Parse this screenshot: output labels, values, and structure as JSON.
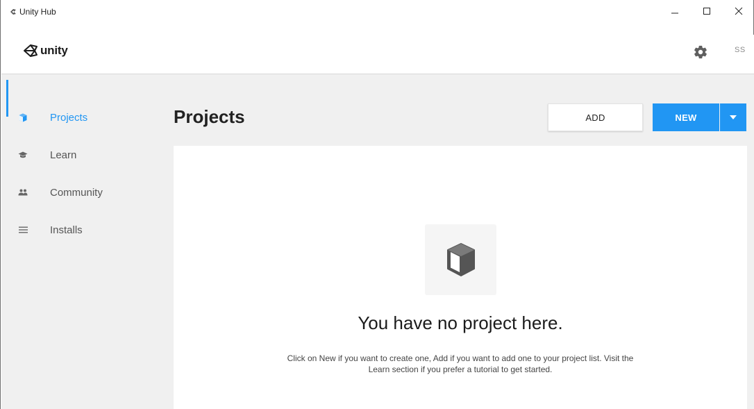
{
  "window": {
    "title": "Unity Hub",
    "controls": [
      "minimize",
      "maximize",
      "close"
    ]
  },
  "header": {
    "logo_text": "unity",
    "settings_icon": "gear-icon",
    "user_initials": "SS"
  },
  "sidebar": {
    "items": [
      {
        "label": "Projects",
        "icon": "cube-icon",
        "active": true
      },
      {
        "label": "Learn",
        "icon": "graduation-cap-icon",
        "active": false
      },
      {
        "label": "Community",
        "icon": "people-icon",
        "active": false
      },
      {
        "label": "Installs",
        "icon": "list-icon",
        "active": false
      }
    ]
  },
  "main": {
    "title": "Projects",
    "add_label": "ADD",
    "new_label": "NEW",
    "empty_state": {
      "title": "You have no project here.",
      "description": "Click on New if you want to create one, Add if you want to add one to your project list. Visit the Learn section if you prefer a tutorial to get started."
    }
  },
  "colors": {
    "accent": "#2196f3",
    "background": "#f0f0f0",
    "panel": "#ffffff"
  }
}
